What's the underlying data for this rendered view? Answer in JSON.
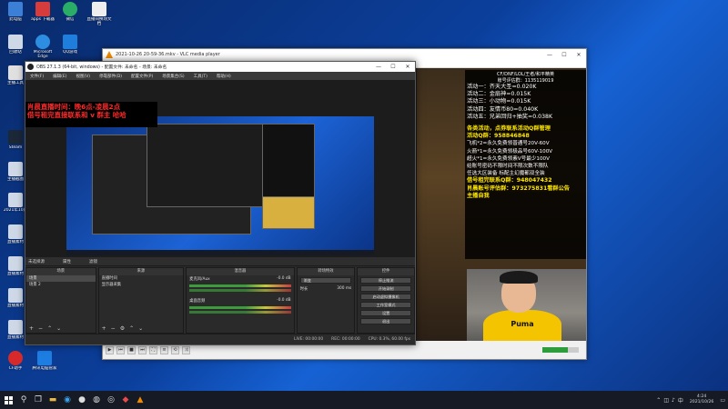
{
  "desktop": {
    "top_icons": [
      {
        "label": "此电脑",
        "color": "#3c7fd6"
      },
      {
        "label": "apps 下载器",
        "color": "#d63c3c"
      },
      {
        "label": "微信",
        "color": "#2aae67"
      },
      {
        "label": "直播间换场文档",
        "color": "#eeeeee"
      }
    ],
    "left_icons": [
      {
        "label": "回收站",
        "color": "#cfd8e6"
      },
      {
        "label": "Microsoft Edge",
        "color": "#2d8de0"
      },
      {
        "label": "QQ游戏",
        "color": "#1f7ddc"
      },
      {
        "label": "主播工具",
        "color": "#e0e0e0"
      },
      {
        "label": "Steam",
        "color": "#1b2838"
      },
      {
        "label": "主播截图",
        "color": "#cfd8e6"
      },
      {
        "label": "2021年10月",
        "color": "#cfd8e6"
      },
      {
        "label": "直播素材",
        "color": "#cfd8e6"
      },
      {
        "label": "直播素材",
        "color": "#cfd8e6"
      },
      {
        "label": "直播素材",
        "color": "#cfd8e6"
      },
      {
        "label": "直播素材",
        "color": "#cfd8e6"
      },
      {
        "label": "CF助手",
        "color": "#d62a2a"
      },
      {
        "label": "腾讯电脑管家",
        "color": "#1e7de0"
      }
    ]
  },
  "vlc": {
    "title": "2021-10-26 20-59-36.mkv - VLC media player",
    "controls": [
      "play",
      "prev",
      "stop",
      "next",
      "fullscreen",
      "playlist",
      "loop",
      "random"
    ]
  },
  "stream_panel": {
    "header": "CF/DNF/LOL/王者/和平精英",
    "header2": "账号评估群：1135119019",
    "activities": [
      "活动一：齐天大圣=0.020K",
      "活动二：金扇神=0.015K",
      "活动三：小动物=0.015K",
      "活动四：友情币80=0.040K",
      "活动五：兄弟回归+抽奖=0.038K"
    ],
    "promo1": "各类活动，点券联系活动Q群管理",
    "promo2": "活动Q群：958846848",
    "lines": [
      "飞机*2=永久免费领普通号20V-60V",
      "火箭*1=永久免费领极品号60V-100V",
      "超火*1=永久免费领素V号最少100V",
      "给账号密码不限时间不限次数不限队",
      "任选大区装备 标配主幻魔都双全装"
    ],
    "promo3": "借号租完联系Q群：948047432",
    "promo4": "肖晨账号评估群：973275831看群公告",
    "promo5": "主播自我"
  },
  "cam": {
    "shirt_text": "Puma"
  },
  "obs": {
    "title": "OBS 27.1.3 (64-bit, windows) - 配置文件: 未命名 - 场景: 未命名",
    "menu": [
      "文件(F)",
      "编辑(E)",
      "视图(V)",
      "停靠部件(D)",
      "配置文件(P)",
      "场景集合(S)",
      "工具(T)",
      "帮助(H)"
    ],
    "banner_line1": "肖晨直播时间：晚6点-凌晨2点",
    "banner_line2": "借号租完直接联系和 v 群主 哈哈",
    "source_bar": [
      "未选择源",
      "属性",
      "滤镜"
    ],
    "docks": {
      "scenes_title": "场景",
      "scenes": [
        "场景",
        "场景 2"
      ],
      "sources_title": "来源",
      "sources": [
        "直播时间",
        "显示器采集"
      ],
      "mixer_title": "混音器",
      "mixer": [
        {
          "name": "麦克风/Aux",
          "db": "-0.0 dB"
        },
        {
          "name": "桌面音频",
          "db": "-0.0 dB"
        }
      ],
      "transitions_title": "转场特效",
      "transition_name": "渐变",
      "duration_label": "时长",
      "duration_value": "300 ms",
      "controls_title": "控件",
      "controls": [
        "停止推流",
        "开始录制",
        "启动虚拟摄像机",
        "工作室模式",
        "设置",
        "退出"
      ]
    },
    "status": {
      "live": "LIVE: 00:00:00",
      "rec": "REC: 00:00:00",
      "cpu": "CPU: 0.3%, 60.00 fps"
    }
  },
  "taskbar": {
    "time": "4:24",
    "date": "2021/10/26",
    "apps": [
      {
        "name": "search",
        "glyph": "⚲"
      },
      {
        "name": "task-view",
        "glyph": "❐"
      },
      {
        "name": "file-explorer",
        "glyph": "▬"
      },
      {
        "name": "edge",
        "glyph": "◉"
      },
      {
        "name": "obs",
        "glyph": "●"
      },
      {
        "name": "app",
        "glyph": "◍"
      },
      {
        "name": "app2",
        "glyph": "◎"
      },
      {
        "name": "app3",
        "glyph": "◆"
      },
      {
        "name": "vlc",
        "glyph": "▲"
      }
    ]
  }
}
